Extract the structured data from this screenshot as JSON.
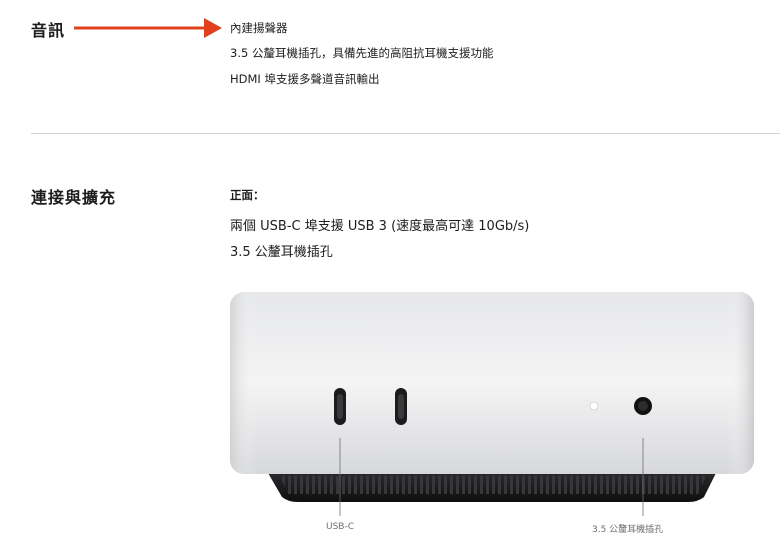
{
  "audio": {
    "heading": "音訊",
    "items": [
      "內建揚聲器",
      "3.5 公釐耳機插孔，具備先進的高阻抗耳機支援功能",
      "HDMI 埠支援多聲道音訊輸出"
    ]
  },
  "connectivity": {
    "heading": "連接與擴充",
    "subheading": "正面：",
    "items": [
      "兩個 USB-C 埠支援 USB 3 (速度最高可達 10Gb/s)",
      "3.5 公釐耳機插孔"
    ]
  },
  "device": {
    "labels": {
      "usb_c": "USB-C",
      "headphone": "3.5 公釐耳機插孔"
    }
  },
  "colors": {
    "arrow": "#e2401c",
    "text": "#1d1d1f",
    "divider": "#d2d2d7"
  }
}
